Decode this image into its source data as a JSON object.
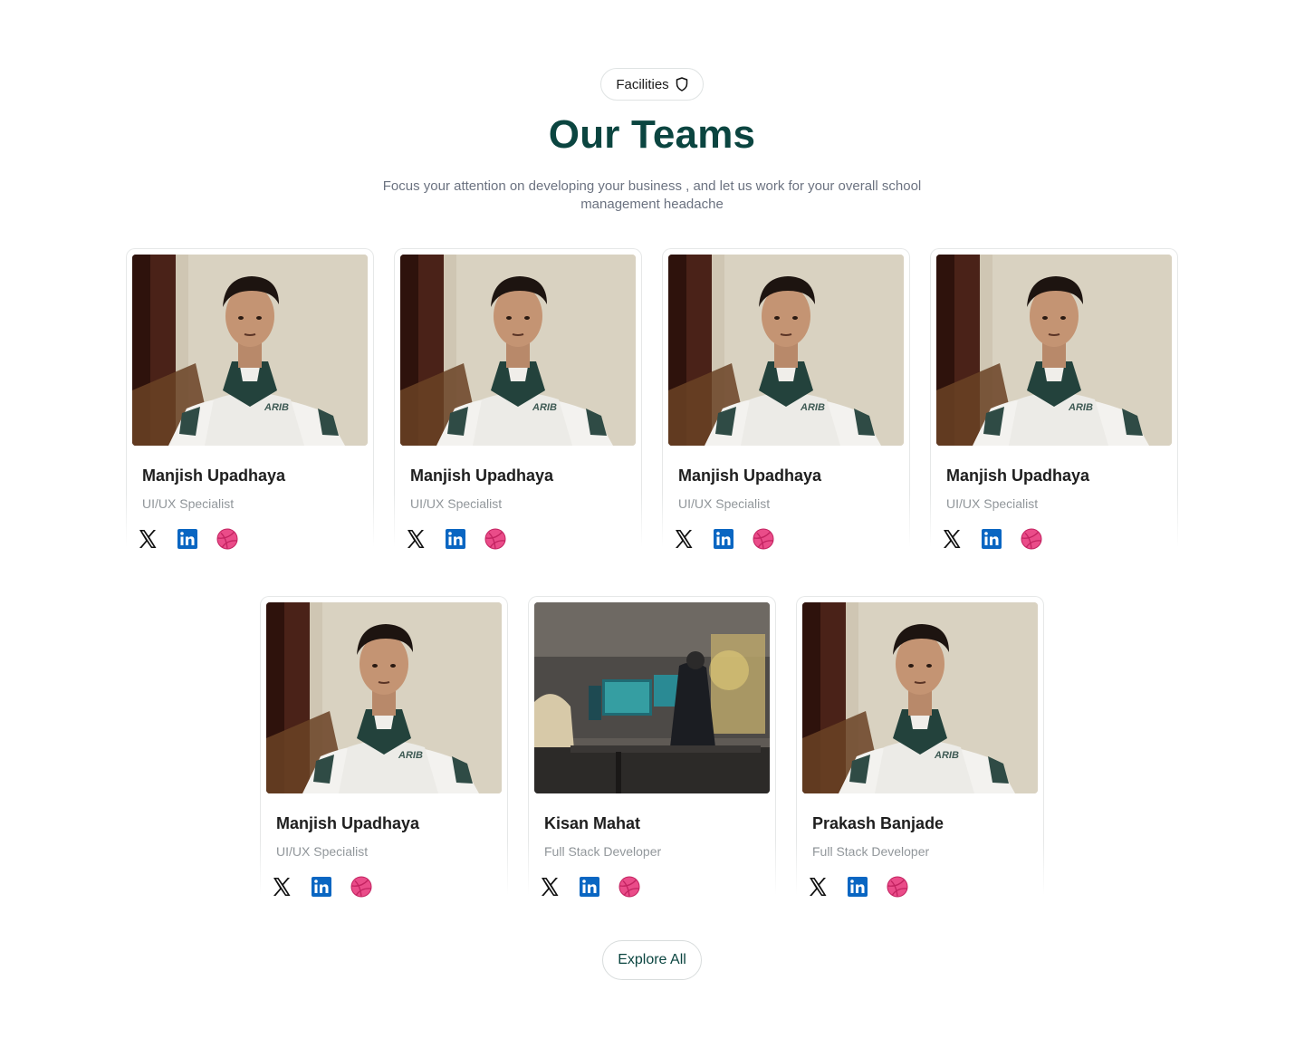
{
  "header": {
    "badge_label": "Facilities",
    "title": "Our Teams",
    "subtitle": "Focus your attention on developing your business , and let us  work for your overall school management headache"
  },
  "team": [
    {
      "name": "Manjish Upadhaya",
      "role": "UI/UX Specialist",
      "photo": "portrait"
    },
    {
      "name": "Manjish Upadhaya",
      "role": "UI/UX Specialist",
      "photo": "portrait"
    },
    {
      "name": "Manjish Upadhaya",
      "role": "UI/UX Specialist",
      "photo": "portrait"
    },
    {
      "name": "Manjish Upadhaya",
      "role": "UI/UX Specialist",
      "photo": "portrait"
    },
    {
      "name": "Manjish Upadhaya",
      "role": "UI/UX Specialist",
      "photo": "portrait"
    },
    {
      "name": "Kisan Mahat",
      "role": "Full Stack Developer",
      "photo": "workspace"
    },
    {
      "name": "Prakash Banjade",
      "role": "Full Stack Developer",
      "photo": "portrait"
    }
  ],
  "socials": [
    "x-icon",
    "linkedin-icon",
    "dribbble-icon"
  ],
  "colors": {
    "title": "#0b4540",
    "linkedin": "#0a66c2",
    "dribbble": "#ea4c89"
  },
  "footer": {
    "explore_label": "Explore All"
  }
}
